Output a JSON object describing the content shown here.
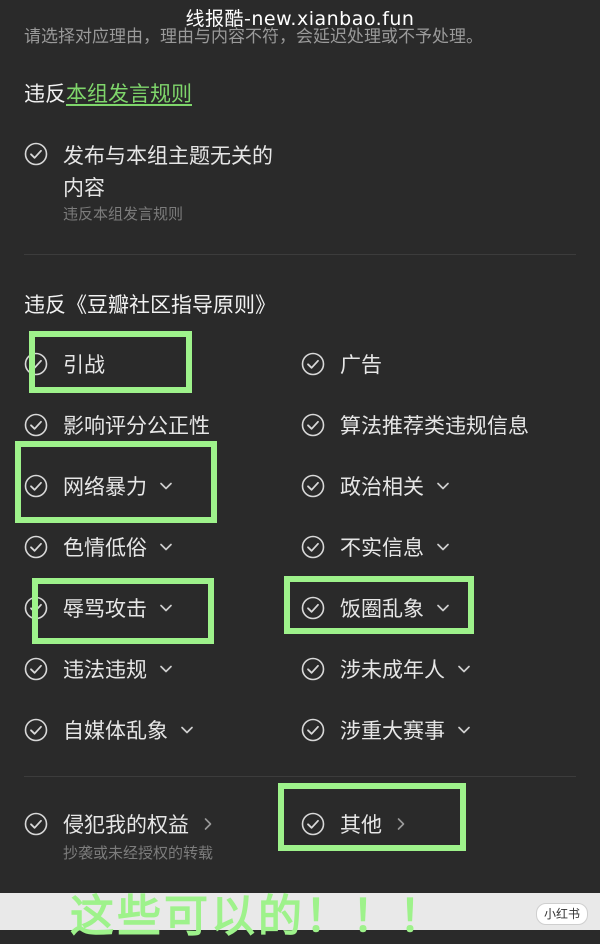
{
  "watermark": "线报酷-new.xianbao.fun",
  "instruction": "请选择对应理由，理由与内容不符，会延迟处理或不予处理。",
  "section1": {
    "prefix": "违反",
    "link": "本组发言规则",
    "option": {
      "label_line1": "发布与本组主题无关的",
      "label_line2": "内容",
      "sub": "违反本组发言规则"
    }
  },
  "section2": {
    "title": "违反《豆瓣社区指导原则》",
    "left": [
      {
        "label": "引战"
      },
      {
        "label": "影响评分公正性"
      },
      {
        "label": "网络暴力"
      },
      {
        "label": "色情低俗"
      },
      {
        "label": "辱骂攻击"
      },
      {
        "label": "违法违规"
      },
      {
        "label": "自媒体乱象"
      }
    ],
    "right": [
      {
        "label": "广告"
      },
      {
        "label": "算法推荐类违规信息"
      },
      {
        "label": "政治相关"
      },
      {
        "label": "不实信息"
      },
      {
        "label": "饭圈乱象"
      },
      {
        "label": "涉未成年人"
      },
      {
        "label": "涉重大赛事"
      }
    ]
  },
  "section3": {
    "rights": {
      "label": "侵犯我的权益",
      "sub": "抄袭或未经授权的转载"
    },
    "other": {
      "label": "其他"
    }
  },
  "caption": "这些可以的！！！",
  "logo": "小红书",
  "colors": {
    "highlight": "#9ef28b",
    "link": "#7fd66b",
    "background": "#2a2a2a"
  }
}
